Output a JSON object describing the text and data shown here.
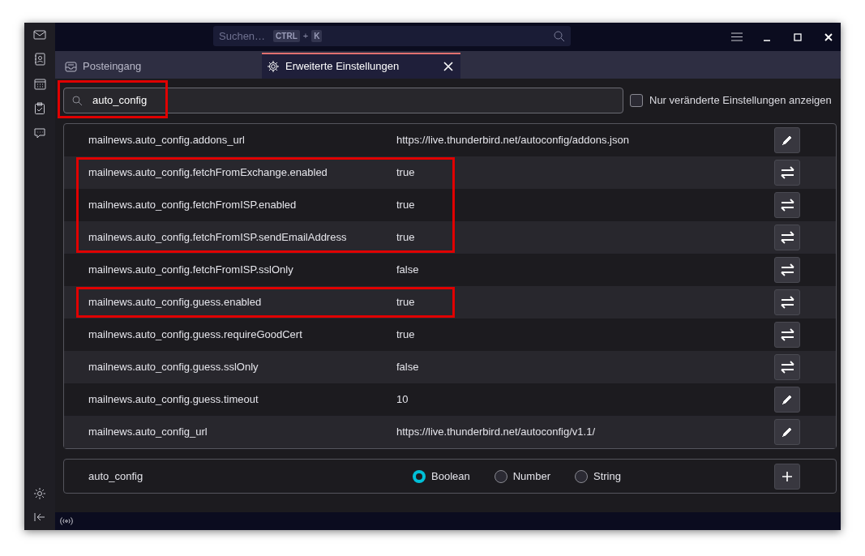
{
  "search_box": {
    "placeholder": "Suchen…",
    "shortcut": [
      "CTRL",
      "+",
      "K"
    ]
  },
  "tabs": [
    {
      "label": "Posteingang",
      "kind": "inbox",
      "selected": false
    },
    {
      "label": "Erweiterte Einstellungen",
      "kind": "settings",
      "selected": true
    }
  ],
  "filter": {
    "value": "auto_config",
    "highlighted": true
  },
  "modified_only": {
    "label": "Nur veränderte Einstellungen anzeigen",
    "checked": false
  },
  "preferences": [
    {
      "name": "mailnews.auto_config.addons_url",
      "value": "https://live.thunderbird.net/autoconfig/addons.json",
      "kind": "edit",
      "highlighted": false
    },
    {
      "name": "mailnews.auto_config.fetchFromExchange.enabled",
      "value": "true",
      "kind": "toggle",
      "highlighted": true
    },
    {
      "name": "mailnews.auto_config.fetchFromISP.enabled",
      "value": "true",
      "kind": "toggle",
      "highlighted": true
    },
    {
      "name": "mailnews.auto_config.fetchFromISP.sendEmailAddress",
      "value": "true",
      "kind": "toggle",
      "highlighted": true
    },
    {
      "name": "mailnews.auto_config.fetchFromISP.sslOnly",
      "value": "false",
      "kind": "toggle",
      "highlighted": false
    },
    {
      "name": "mailnews.auto_config.guess.enabled",
      "value": "true",
      "kind": "toggle",
      "highlighted": true
    },
    {
      "name": "mailnews.auto_config.guess.requireGoodCert",
      "value": "true",
      "kind": "toggle",
      "highlighted": false
    },
    {
      "name": "mailnews.auto_config.guess.sslOnly",
      "value": "false",
      "kind": "toggle",
      "highlighted": false
    },
    {
      "name": "mailnews.auto_config.guess.timeout",
      "value": "10",
      "kind": "edit",
      "highlighted": false
    },
    {
      "name": "mailnews.auto_config_url",
      "value": "https://live.thunderbird.net/autoconfig/v1.1/",
      "kind": "edit",
      "highlighted": false
    }
  ],
  "new_preference": {
    "name": "auto_config",
    "types": [
      {
        "label": "Boolean",
        "selected": true
      },
      {
        "label": "Number",
        "selected": false
      },
      {
        "label": "String",
        "selected": false
      }
    ]
  }
}
